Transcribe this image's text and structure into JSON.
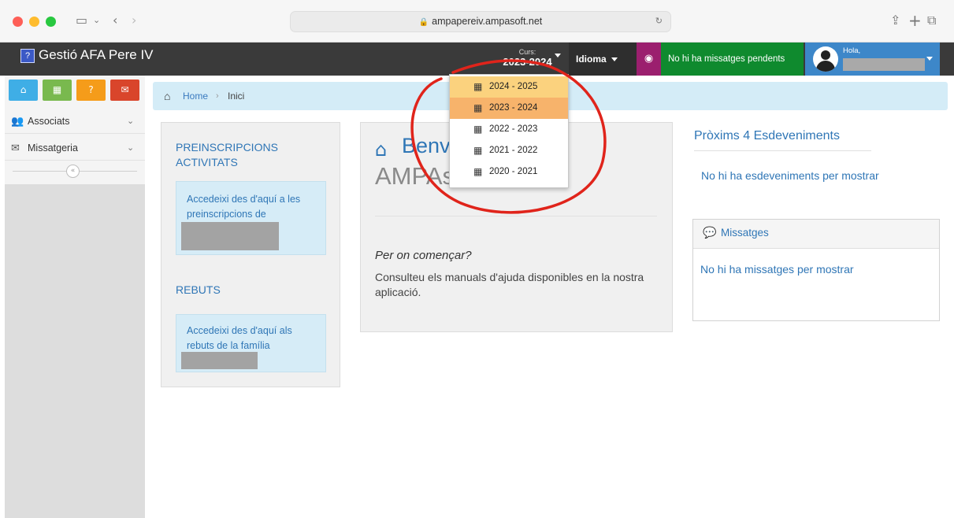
{
  "browser": {
    "url": "ampapereiv.ampasoft.net"
  },
  "header": {
    "app_title": "Gestió AFA Pere IV",
    "curs_label": "Curs:",
    "curs_value": "2023-2024",
    "language_label": "Idioma",
    "messages_status": "No hi ha missatges pendents",
    "greeting": "Hola,"
  },
  "course_dropdown": {
    "items": [
      {
        "label": "2024 - 2025",
        "state": "hover"
      },
      {
        "label": "2023 - 2024",
        "state": "selected"
      },
      {
        "label": "2022 - 2023",
        "state": "normal"
      },
      {
        "label": "2021 - 2022",
        "state": "normal"
      },
      {
        "label": "2020 - 2021",
        "state": "normal"
      }
    ]
  },
  "sidebar": {
    "items": [
      {
        "label": "Associats",
        "icon": "users-icon"
      },
      {
        "label": "Missatgeria",
        "icon": "envelope-icon"
      }
    ]
  },
  "breadcrumb": {
    "home": "Home",
    "separator": "›",
    "current": "Inici"
  },
  "left_panel": {
    "section1_title": "PREINSCRIPCIONS ACTIVITATS",
    "section1_text": "Accedeixi des d'aquí a les preinscripcions de",
    "section2_title": "REBUTS",
    "section2_text": "Accedeixi des d'aquí als rebuts de la família"
  },
  "center_panel": {
    "welcome_text": "Benvingut a",
    "app_name": "AMPAsoft",
    "start_heading": "Per on començar?",
    "start_text": "Consulteu els manuals d'ajuda disponibles en la nostra aplicació."
  },
  "right_panel": {
    "events_title": "Pròxims 4 Esdeveniments",
    "events_empty": "No hi ha esdeveniments per mostrar",
    "messages_title": "Missatges",
    "messages_empty": "No hi ha missatges per mostrar"
  },
  "colors": {
    "header_bg": "#3a3a3a",
    "globe_bg": "#9b1f6e",
    "messages_bg": "#0f8a2e",
    "user_bg": "#3d87c9",
    "link_blue": "#2f76b6",
    "annotation_red": "#e0241b"
  }
}
